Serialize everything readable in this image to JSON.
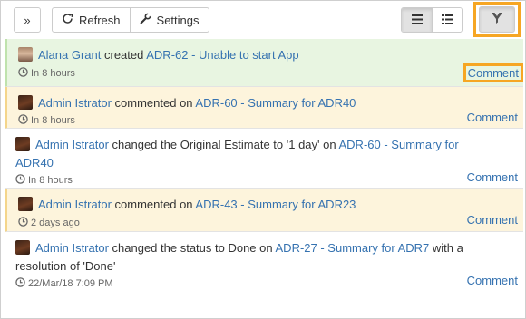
{
  "toolbar": {
    "expand_label": "»",
    "refresh_label": "Refresh",
    "settings_label": "Settings",
    "refresh_icon": "refresh-icon",
    "settings_icon": "wrench-icon",
    "view_list_icon": "list-view-icon",
    "view_detail_icon": "detail-view-icon",
    "filter_icon": "filter-icon"
  },
  "colors": {
    "link": "#3572b0",
    "highlight": "#f6a623",
    "created_bg": "#e8f5e1",
    "comment_bg": "#fdf4dc"
  },
  "feed": [
    {
      "kind": "created",
      "user": "Alana Grant",
      "action": " created ",
      "issue": "ADR-62 - Unable to start App",
      "time": "In 8 hours",
      "comment_label": "Comment"
    },
    {
      "kind": "commented",
      "user": "Admin Istrator",
      "action": " commented on ",
      "issue": "ADR-60 - Summary for ADR40",
      "time": "In 8 hours",
      "comment_label": "Comment"
    },
    {
      "kind": "changed",
      "user": "Admin Istrator",
      "action": " changed the Original Estimate to '1 day' on ",
      "issue_part1": "ADR-60 - Summary for",
      "issue_part2": "ADR40",
      "time": "In 8 hours",
      "comment_label": "Comment"
    },
    {
      "kind": "commented",
      "user": "Admin Istrator",
      "action": " commented on ",
      "issue": "ADR-43 - Summary for ADR23",
      "time": "2 days ago",
      "comment_label": "Comment"
    },
    {
      "kind": "changed",
      "user": "Admin Istrator",
      "action": " changed the status to Done on ",
      "issue": "ADR-27 - Summary for ADR7",
      "action2": " with a",
      "line2": "resolution of 'Done'",
      "time": "22/Mar/18 7:09 PM",
      "comment_label": "Comment"
    }
  ]
}
